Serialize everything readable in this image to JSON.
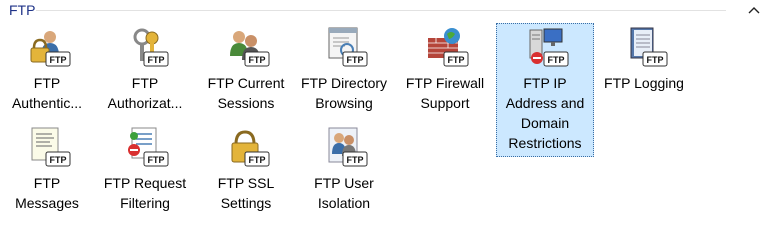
{
  "group": {
    "title": "FTP",
    "collapse_icon": "chevron-up-icon"
  },
  "items": [
    {
      "label": "FTP\nAuthentic...",
      "icon": "ftp-authentication-icon"
    },
    {
      "label": "FTP\nAuthorizat...",
      "icon": "ftp-authorization-icon"
    },
    {
      "label": "FTP Current\nSessions",
      "icon": "ftp-current-sessions-icon"
    },
    {
      "label": "FTP Directory\nBrowsing",
      "icon": "ftp-directory-browsing-icon"
    },
    {
      "label": "FTP Firewall\nSupport",
      "icon": "ftp-firewall-support-icon"
    },
    {
      "label": "FTP IP\nAddress and\nDomain\nRestrictions",
      "icon": "ftp-ip-restrictions-icon",
      "selected": true
    },
    {
      "label": "FTP Logging",
      "icon": "ftp-logging-icon"
    },
    {
      "label": "FTP\nMessages",
      "icon": "ftp-messages-icon"
    },
    {
      "label": "FTP Request\nFiltering",
      "icon": "ftp-request-filtering-icon"
    },
    {
      "label": "FTP SSL\nSettings",
      "icon": "ftp-ssl-settings-icon"
    },
    {
      "label": "FTP User\nIsolation",
      "icon": "ftp-user-isolation-icon"
    }
  ],
  "badge_text": "FTP",
  "colors": {
    "title": "#1e3287",
    "selection_fill": "#cce8ff",
    "selection_border": "#3a6ea5"
  }
}
